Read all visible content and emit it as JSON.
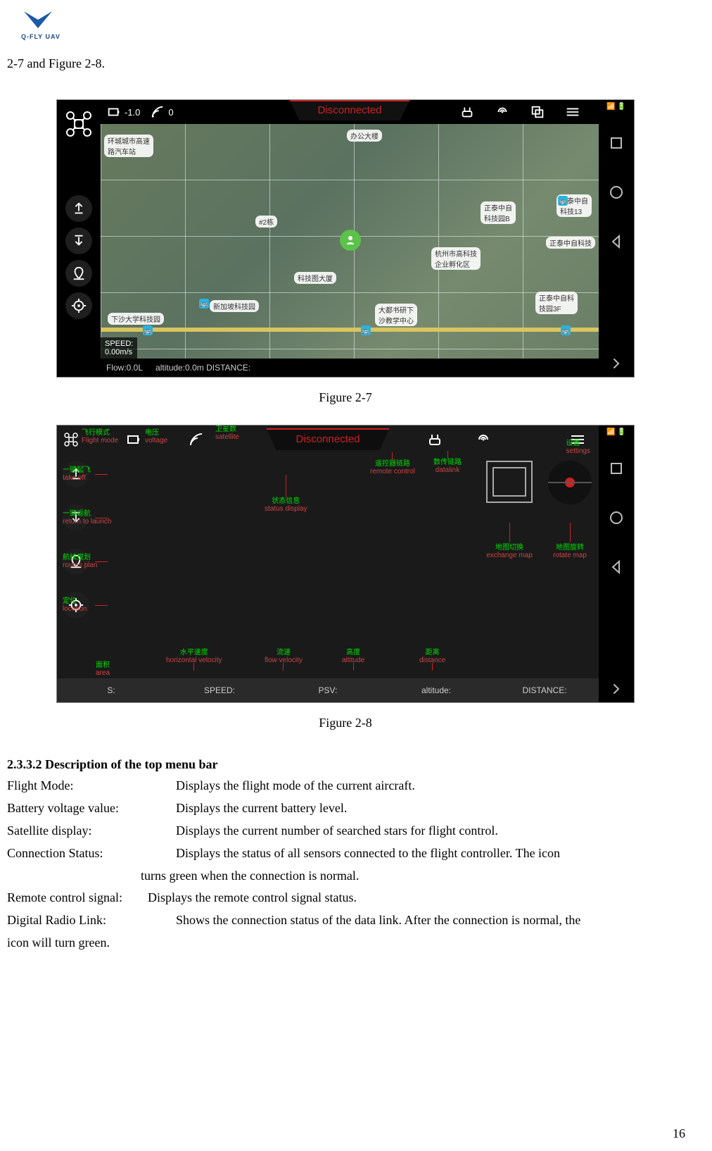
{
  "page_number": "16",
  "header_logo_text": "Q-FLY UAV",
  "pre_text": "2-7 and Figure 2-8.",
  "fig27_caption": "Figure 2-7",
  "fig28_caption": "Figure 2-8",
  "topbar_a": {
    "voltage": "-1.0",
    "sat": "0",
    "disconnected": "Disconnected"
  },
  "bottombar_a": {
    "speed_label": "SPEED:",
    "speed_val_overlay": "0.00m/s",
    "flow": "Flow:0.0L",
    "altitude": "altitude:0.0m",
    "distance": "DISTANCE:"
  },
  "map_labels": {
    "l1": "办公大楼",
    "l2": "#2栋",
    "l3": "科技图大厦",
    "l4": "新加坡科技园",
    "l5": "正泰中自\n科技园B",
    "l6": "正泰中自\n科技13",
    "l7": "杭州市高科技\n企业孵化区",
    "l8": "正泰中自科技",
    "l9": "正泰中自科\n技园3F",
    "l10": "大都书研下\n沙教学中心",
    "l11": "下沙大学科技园",
    "l12": "环城城市高速\n路汽车站"
  },
  "topbar_b": {
    "disconnected": "Disconnected"
  },
  "ann": {
    "flight_mode_cn": "飞行模式",
    "flight_mode_en": "Flight mode",
    "voltage_cn": "电压",
    "voltage_en": "voltage",
    "satellite_cn": "卫星数",
    "satellite_en": "satellite",
    "status_cn": "状态信息",
    "status_en": "status display",
    "remote_cn": "遥控器链路",
    "remote_en": "remote control",
    "datalink_cn": "数传链路",
    "datalink_en": "datalink",
    "settings_cn": "设置",
    "settings_en": "settings",
    "takeoff_cn": "一键起飞",
    "takeoff_en": "take off",
    "rtl_cn": "一键返航",
    "rtl_en": "return to launch",
    "routes_cn": "航线规划",
    "routes_en": "routes plan",
    "location_cn": "定位",
    "location_en": "location",
    "exmap_cn": "地图切换",
    "exmap_en": "exchange map",
    "rotmap_cn": "地图旋转",
    "rotmap_en": "rotate map",
    "area_cn": "面积",
    "area_en": "area",
    "hv_cn": "水平速度",
    "hv_en": "horizontal velocity",
    "fv_cn": "流速",
    "fv_en": "flow velocity",
    "alt_cn": "高度",
    "alt_en": "altitude",
    "dist_cn": "距离",
    "dist_en": "distance"
  },
  "bottombar_b": {
    "s": "S:",
    "speed": "SPEED:",
    "psv": "PSV:",
    "altitude": "altitude:",
    "distance": "DISTANCE:"
  },
  "section_title": "2.3.3.2 Description of the top menu bar",
  "descriptions": [
    {
      "label": "Flight Mode:",
      "text": "Displays the flight mode of the current aircraft."
    },
    {
      "label": "Battery voltage value:",
      "text": "Displays the current battery level."
    },
    {
      "label": "Satellite display:",
      "text": "Displays the current number of searched stars for flight control."
    },
    {
      "label": "Connection Status:",
      "text": "Displays the status of all sensors connected to the flight controller. The icon"
    }
  ],
  "conn_cont": "turns green when the connection is normal.",
  "remote_row": {
    "label": "Remote control signal:",
    "text": "Displays the remote control signal status."
  },
  "digital_row": {
    "label": "Digital Radio Link:",
    "text": "Shows the connection status of the data link. After the connection is normal, the"
  },
  "digital_cont": "icon will turn green."
}
